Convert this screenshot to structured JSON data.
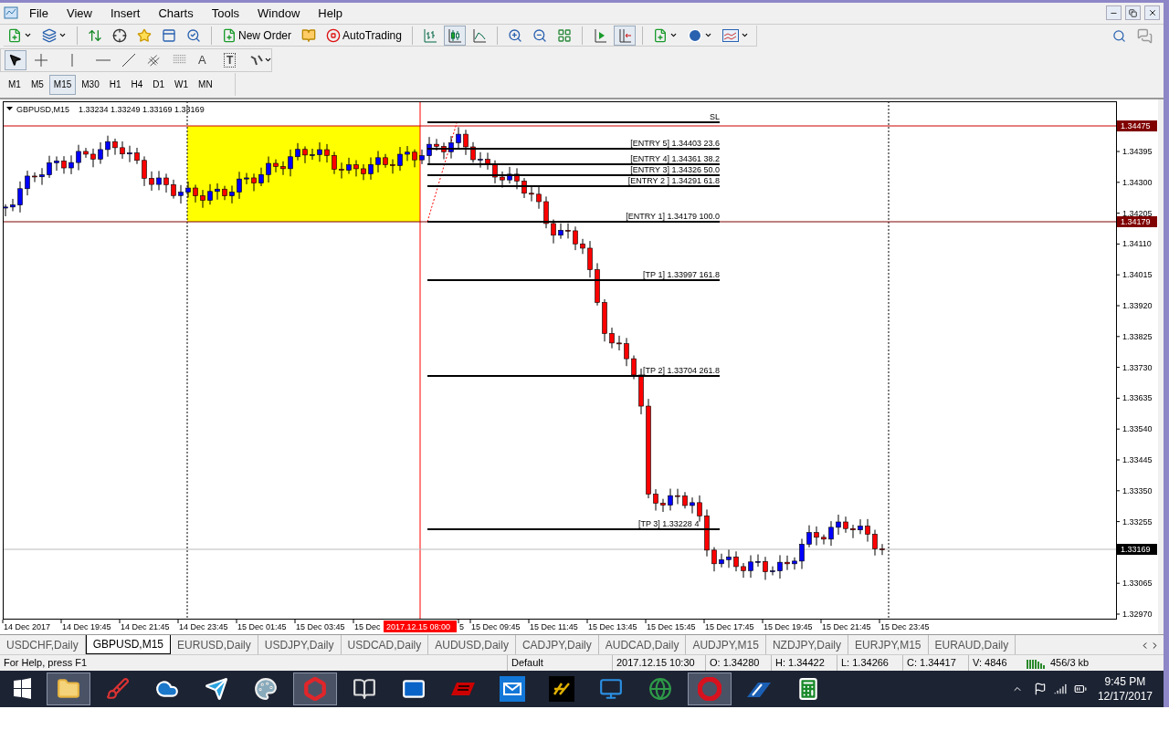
{
  "menu": [
    "File",
    "View",
    "Insert",
    "Charts",
    "Tools",
    "Window",
    "Help"
  ],
  "toolbar": {
    "new_order": "New Order",
    "autotrading": "AutoTrading",
    "chart_types": [
      {
        "kind": "bars",
        "selected": false
      },
      {
        "kind": "candles",
        "selected": true
      },
      {
        "kind": "line",
        "selected": false
      }
    ],
    "auto_scroll": {
      "selected": false
    },
    "chart_shift": {
      "selected": true
    }
  },
  "line_studies": [
    {
      "kind": "cursor",
      "selected": true
    },
    {
      "kind": "crosshair",
      "selected": false
    },
    {
      "kind": "vline",
      "selected": false
    },
    {
      "kind": "hline",
      "selected": false
    },
    {
      "kind": "trendline",
      "selected": false
    },
    {
      "kind": "channel",
      "selected": false
    },
    {
      "kind": "fibo",
      "selected": false
    },
    {
      "kind": "text",
      "glyph": "A",
      "selected": false
    },
    {
      "kind": "label",
      "glyph": "T",
      "selected": false
    },
    {
      "kind": "arrows",
      "selected": false
    }
  ],
  "timeframes": [
    {
      "label": "M1",
      "selected": false
    },
    {
      "label": "M5",
      "selected": false
    },
    {
      "label": "M15",
      "selected": true
    },
    {
      "label": "M30",
      "selected": false
    },
    {
      "label": "H1",
      "selected": false
    },
    {
      "label": "H4",
      "selected": false
    },
    {
      "label": "D1",
      "selected": false
    },
    {
      "label": "W1",
      "selected": false
    },
    {
      "label": "MN",
      "selected": false
    }
  ],
  "chart": {
    "symbol": "GBPUSD,M15",
    "quote": "1.33234 1.33249 1.33169 1.33169",
    "price_ticks": [
      "1.34395",
      "1.34300",
      "1.34205",
      "1.34110",
      "1.34015",
      "1.33920",
      "1.33825",
      "1.33730",
      "1.33635",
      "1.33540",
      "1.33445",
      "1.33350",
      "1.33255",
      "1.33065",
      "1.32970"
    ],
    "price_markers": [
      {
        "text": "1.34475",
        "color": "#800000"
      },
      {
        "text": "1.34179",
        "color": "#800000"
      },
      {
        "text": "1.33169",
        "color": "#000000"
      }
    ],
    "levels": [
      {
        "label": "SL"
      },
      {
        "label": "[ENTRY 5] 1.34403 23.6"
      },
      {
        "label": "[ENTRY 4] 1.34361 38.2"
      },
      {
        "label": "[ENTRY 3] 1.34326 50.0"
      },
      {
        "label": "[ENTRY 2 ] 1.34291 61.8"
      },
      {
        "label": "[ENTRY 1] 1.34179 100.0"
      },
      {
        "label": "[TP 1] 1.33997 161.8"
      },
      {
        "label": "[TP 2] 1.33704 261.8"
      },
      {
        "label": "[TP 3] 1.33228 4"
      }
    ],
    "time_labels": [
      "14 Dec 2017",
      "14 Dec 19:45",
      "14 Dec 21:45",
      "14 Dec 23:45",
      "15 Dec 01:45",
      "15 Dec 03:45",
      "15 Dec",
      "5",
      "15 Dec 09:45",
      "15 Dec 11:45",
      "15 Dec 13:45",
      "15 Dec 15:45",
      "15 Dec 17:45",
      "15 Dec 19:45",
      "15 Dec 21:45",
      "15 Dec 23:45"
    ],
    "cursor_time": "2017.12.15 08:00"
  },
  "tabs": [
    {
      "label": "USDCHF,Daily",
      "selected": false
    },
    {
      "label": "GBPUSD,M15",
      "selected": true
    },
    {
      "label": "EURUSD,Daily",
      "selected": false
    },
    {
      "label": "USDJPY,Daily",
      "selected": false
    },
    {
      "label": "USDCAD,Daily",
      "selected": false
    },
    {
      "label": "AUDUSD,Daily",
      "selected": false
    },
    {
      "label": "CADJPY,Daily",
      "selected": false
    },
    {
      "label": "AUDCAD,Daily",
      "selected": false
    },
    {
      "label": "AUDJPY,M15",
      "selected": false
    },
    {
      "label": "NZDJPY,Daily",
      "selected": false
    },
    {
      "label": "EURJPY,M15",
      "selected": false
    },
    {
      "label": "EURAUD,Daily",
      "selected": false
    }
  ],
  "status_bar": {
    "help": "For Help, press F1",
    "profile": "Default",
    "time": "2017.12.15 10:30",
    "open": "O: 1.34280",
    "high": "H: 1.34422",
    "low": "L: 1.34266",
    "close": "C: 1.34417",
    "volume": "V: 4846",
    "traffic": "456/3 kb"
  },
  "taskbar": {
    "apps": [
      {
        "kind": "folder",
        "active": true
      },
      {
        "kind": "broom",
        "active": false
      },
      {
        "kind": "cloud",
        "active": false
      },
      {
        "kind": "plane",
        "active": false
      },
      {
        "kind": "palette",
        "active": false
      },
      {
        "kind": "hexagon",
        "active": true
      },
      {
        "kind": "book",
        "active": false
      },
      {
        "kind": "mail-o",
        "active": false
      },
      {
        "kind": "logo",
        "active": false
      },
      {
        "kind": "mail",
        "active": false
      },
      {
        "kind": "fx",
        "active": false
      },
      {
        "kind": "remote",
        "active": false
      },
      {
        "kind": "globe",
        "active": false
      },
      {
        "kind": "ring",
        "active": true
      },
      {
        "kind": "stripes",
        "active": false
      },
      {
        "kind": "calculator",
        "active": false
      }
    ],
    "time": "9:45 PM",
    "date": "12/17/2017"
  }
}
